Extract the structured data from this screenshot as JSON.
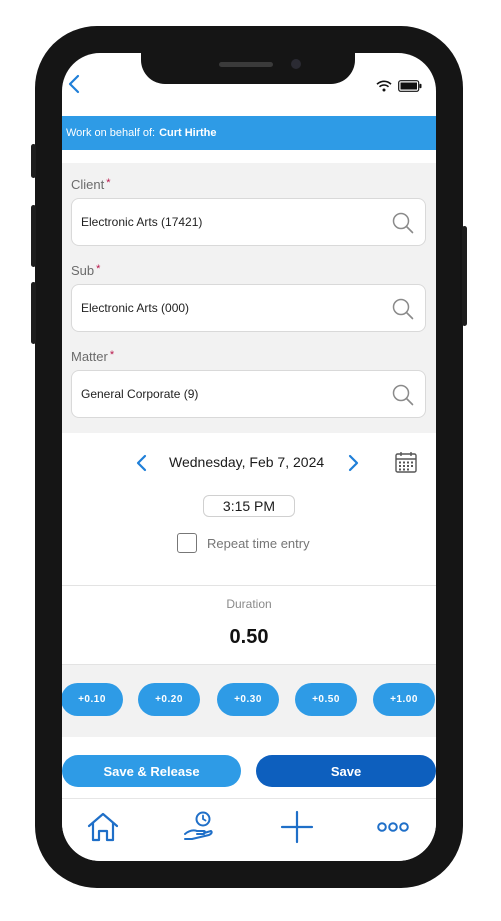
{
  "status_bar": {
    "wifi_icon": "wifi-icon",
    "battery_icon": "battery-icon"
  },
  "header": {
    "back_icon": "chevron-left-icon"
  },
  "banner": {
    "prefix": "Work on behalf of:",
    "name": "Curt Hirthe"
  },
  "form": {
    "client": {
      "label": "Client",
      "required_mark": "*",
      "value": "Electronic Arts (17421)"
    },
    "sub": {
      "label": "Sub",
      "required_mark": "*",
      "value": "Electronic Arts (000)"
    },
    "matter": {
      "label": "Matter",
      "required_mark": "*",
      "value": "General Corporate (9)"
    }
  },
  "date": {
    "text": "Wednesday, Feb 7, 2024"
  },
  "time": {
    "text": "3:15 PM"
  },
  "repeat": {
    "label": "Repeat time entry",
    "checked": false
  },
  "duration": {
    "label": "Duration",
    "value": "0.50"
  },
  "increments": [
    "+0.10",
    "+0.20",
    "+0.30",
    "+0.50",
    "+1.00"
  ],
  "actions": {
    "save_release": "Save & Release",
    "save": "Save"
  },
  "nav": [
    "home-icon",
    "timer-hand-icon",
    "plus-icon",
    "more-icon"
  ],
  "colors": {
    "accent": "#2e9be6",
    "primary_dark": "#0d5fbe",
    "required": "#b8164a"
  }
}
